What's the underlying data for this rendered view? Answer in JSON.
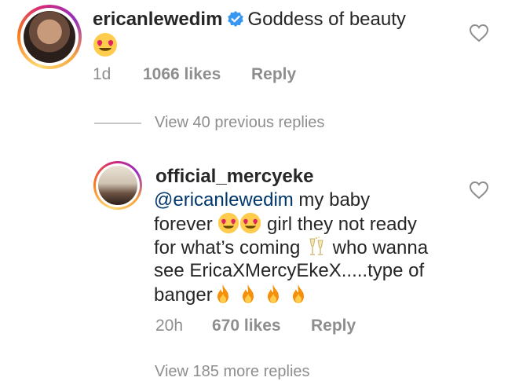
{
  "comment1": {
    "username": "ericanlewedim",
    "text": "Goddess of beauty",
    "time": "1d",
    "likes": "1066 likes",
    "reply_label": "Reply",
    "emoji": "heart-eyes"
  },
  "thread": {
    "view_previous": "View 40 previous replies"
  },
  "comment2": {
    "username": "official_mercyeke",
    "mention": "@ericanlewedim",
    "line1_rest": " my baby",
    "line2_a": "forever ",
    "line2_b": " girl they not ready",
    "line3_a": "for what’s coming ",
    "line3_b": " who wanna",
    "line4": "see EricaXMercyEkeX.....type of",
    "line5": "banger",
    "time": "20h",
    "likes": "670 likes",
    "reply_label": "Reply",
    "emojis": [
      "heart-eyes",
      "heart-eyes",
      "champagne",
      "fire",
      "fire",
      "fire",
      "fire"
    ]
  },
  "footer": {
    "partial_text": "View 185 more replies"
  },
  "colors": {
    "text": "#262626",
    "meta": "#8e8e8e",
    "mention": "#00376b",
    "verified": "#3897f0"
  }
}
